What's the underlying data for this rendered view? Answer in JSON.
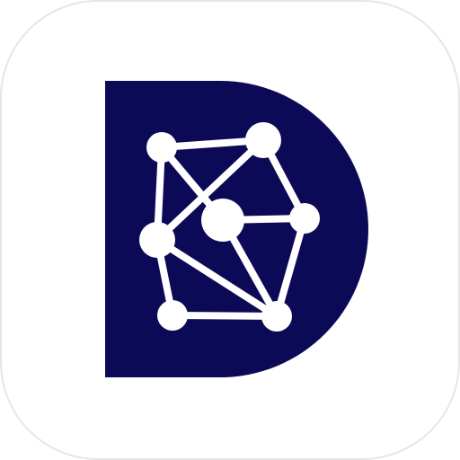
{
  "icon": {
    "name": "network-d-logo-icon",
    "tile_color": "#ffffff",
    "tile_border_color": "#e6e6e6",
    "letter_color": "#0c0a56",
    "network_color": "#ffffff"
  }
}
